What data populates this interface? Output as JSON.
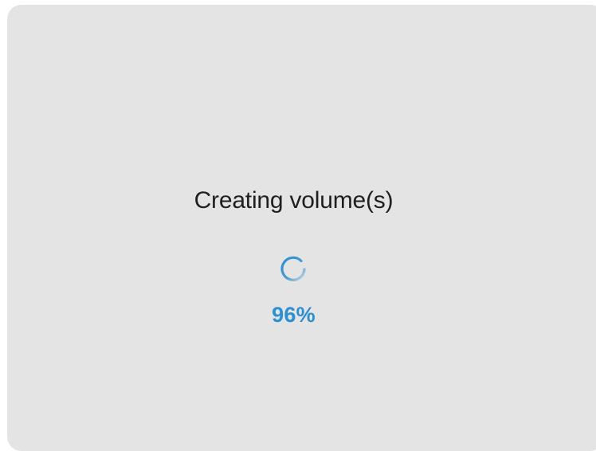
{
  "dialog": {
    "title": "Creating volume(s)",
    "progress_percent": 96,
    "progress_text": "96%",
    "spinner_icon": "loading-spinner-icon",
    "accent_color": "#2B8FD1",
    "background_color": "#E4E4E4",
    "title_color": "#1F1F1F"
  }
}
